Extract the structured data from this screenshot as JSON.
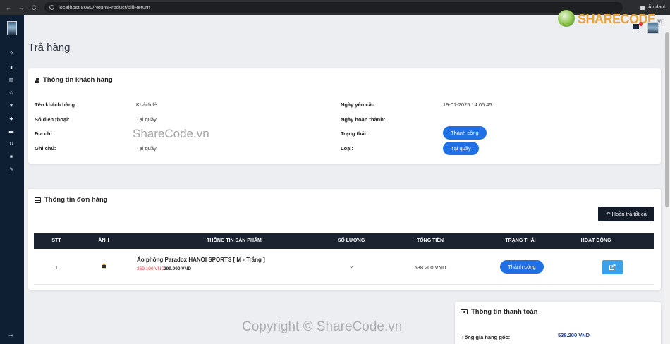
{
  "browser": {
    "url": "localhost:8080/returnProduct/billReturn",
    "back": "←",
    "forward": "→",
    "reload": "C",
    "incognito_label": "Ẩn danh"
  },
  "watermark": {
    "logo_brand": "SHARECODE",
    "logo_suffix": ".vn",
    "center_text": "ShareCode.vn",
    "copyright": "Copyright © ShareCode.vn"
  },
  "page": {
    "title": "Trả hàng"
  },
  "customer": {
    "title": "Thông tin khách hàng",
    "name_label": "Tên khách hàng:",
    "name_value": "Khách lẻ",
    "phone_label": "Số điện thoại:",
    "phone_value": "Tại quầy",
    "address_label": "Địa chỉ:",
    "note_label": "Ghi chú:",
    "note_value": "Tại quầy",
    "request_date_label": "Ngày yêu cầu:",
    "request_date_value": "19-01-2025 14:05:45",
    "complete_date_label": "Ngày hoàn thành:",
    "status_label": "Trạng thái:",
    "status_value": "Thành công",
    "type_label": "Loại:",
    "type_value": "Tại quầy",
    "accent_color": "#1f6fe5"
  },
  "order": {
    "title": "Thông tin đơn hàng",
    "refund_all_label": "Hoàn trả tất cả",
    "columns": [
      "STT",
      "ẢNH",
      "THÔNG TIN SẢN PHẨM",
      "SỐ LƯỢNG",
      "TỔNG TIỀN",
      "TRẠNG THÁI",
      "HOẠT ĐỘNG"
    ],
    "rows": [
      {
        "stt": "1",
        "product_name": "Áo phông Paradox HANOI SPORTS [ M - Trắng ]",
        "price_new": "269.100 VND",
        "price_old": "299.000 VND",
        "quantity": "2",
        "total": "538.200 VND",
        "status": "Thành công"
      }
    ]
  },
  "payment": {
    "title": "Thông tin thanh toán",
    "original_total_label": "Tổng giá hàng gốc:",
    "original_total_value": "538.200 VND"
  },
  "icons": [
    "question-icon",
    "bar-chart-icon",
    "invoice-icon",
    "shield-icon",
    "tshirt-icon",
    "tag-icon",
    "card-icon",
    "refresh-icon",
    "bag-icon",
    "edit-icon",
    "logout-icon"
  ]
}
